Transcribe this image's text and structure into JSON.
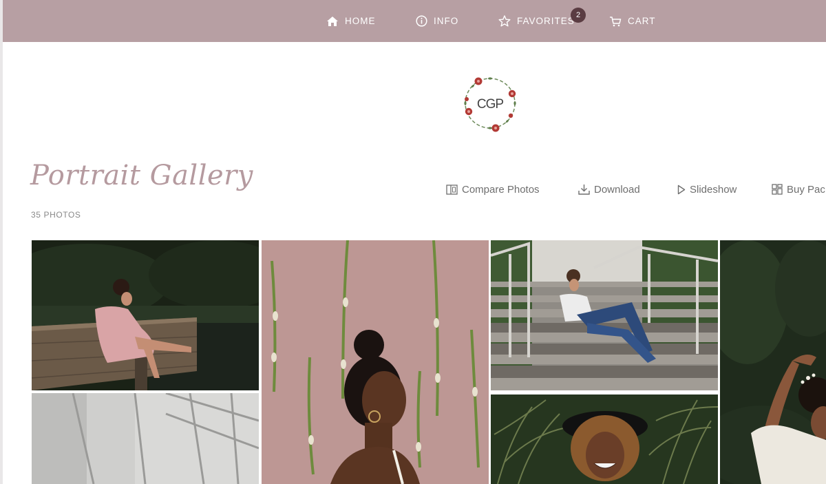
{
  "nav": {
    "home_label": "HOME",
    "info_label": "INFO",
    "favorites_label": "FAVORITES",
    "favorites_count": "2",
    "cart_label": "CART",
    "background": "#b79fa3"
  },
  "logo": {
    "text": "CGP",
    "icon": "floral-wreath-logo"
  },
  "gallery": {
    "title": "Portrait Gallery",
    "photo_count": "35 PHOTOS"
  },
  "actions": {
    "compare_label": "Compare Photos",
    "download_label": "Download",
    "slideshow_label": "Slideshow",
    "buy_label": "Buy Pac"
  },
  "photos": [
    {
      "subject": "woman in pink dress sitting on wooden dock"
    },
    {
      "subject": "woman with hair bun against pink wall with hanging flowers"
    },
    {
      "subject": "woman in jeans sitting on outdoor stairs"
    },
    {
      "subject": "woman with curly hair among green foliage"
    },
    {
      "subject": "grey architectural window shadows"
    },
    {
      "subject": "smiling woman with curly hair in black hat among grasses"
    }
  ]
}
